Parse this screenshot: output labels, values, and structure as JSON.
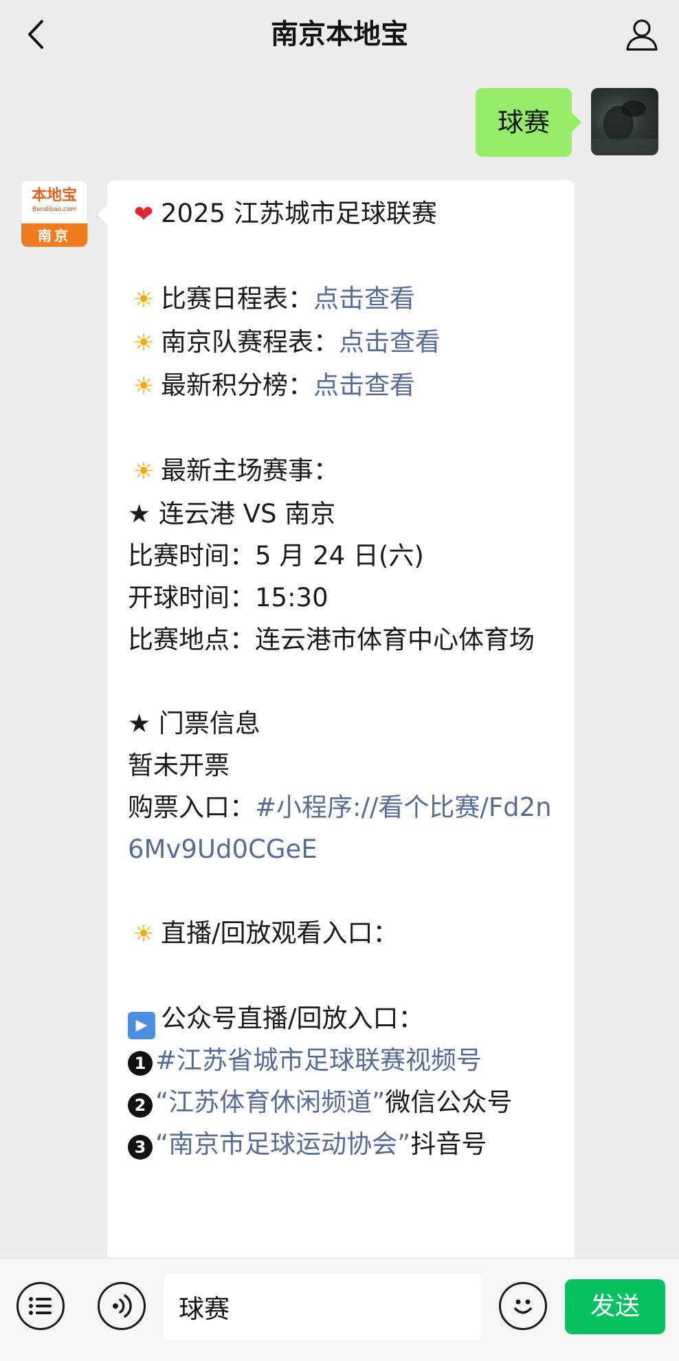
{
  "header": {
    "title": "南京本地宝"
  },
  "outgoing": {
    "text": "球赛"
  },
  "bot_avatar": {
    "logo_text": "本地宝",
    "logo_domain": "Bendibao.com",
    "logo_city": "南京"
  },
  "message": {
    "title": "2025 江苏城市足球联赛",
    "schedule_label": "比赛日程表：",
    "schedule_link": "点击查看",
    "nanjing_label": "南京队赛程表：",
    "nanjing_link": "点击查看",
    "ranking_label": "最新积分榜：",
    "ranking_link": "点击查看",
    "home_title": "最新主场赛事：",
    "match": "★ 连云港 VS 南京",
    "match_time": "比赛时间：5 月 24 日(六)",
    "kickoff": "开球时间：15:30",
    "venue": "比赛地点：连云港市体育中心体育场",
    "ticket_title": "★ 门票信息",
    "ticket_status": "暂未开票",
    "ticket_entry_label": "购票入口：",
    "ticket_entry_link": "#小程序://看个比赛/Fd2n6Mv9Ud0CGeE",
    "live_title": "直播/回放观看入口：",
    "official_title": "公众号直播/回放入口：",
    "item1_link": "#江苏省城市足球联赛视频号",
    "item2_link": "“江苏体育休闲频道”",
    "item2_suffix": "微信公众号",
    "item3_link": "“南京市足球运动协会”",
    "item3_suffix": "抖音号"
  },
  "input_bar": {
    "value": "球赛",
    "send_label": "发送"
  },
  "icons": {
    "back": "chevron-left-icon",
    "profile": "person-icon",
    "heart": "red-heart-icon",
    "sun": "sun-icon",
    "play": "play-button-icon",
    "menu": "list-icon",
    "voice": "voice-icon",
    "emoji": "smiley-icon"
  },
  "colors": {
    "link": "#576b95",
    "outgoing_bubble": "#95ec69",
    "send_button": "#07c160",
    "brand_orange": "#f07c1f"
  }
}
